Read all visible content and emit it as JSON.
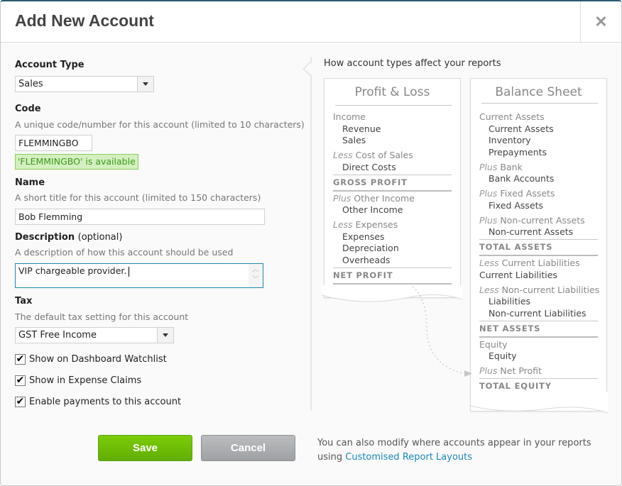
{
  "dialog": {
    "title": "Add New Account",
    "close_icon": "close-icon"
  },
  "form": {
    "account_type": {
      "label": "Account Type",
      "value": "Sales"
    },
    "code": {
      "label": "Code",
      "hint": "A unique code/number for this account (limited to 10 characters)",
      "value": "FLEMMINGBO",
      "availability": "'FLEMMINGBO' is available"
    },
    "name": {
      "label": "Name",
      "hint": "A short title for this account (limited to 150 characters)",
      "value": "Bob Flemming"
    },
    "description": {
      "label": "Description",
      "optional": "(optional)",
      "hint": "A description of how this account should be used",
      "value": "VIP chargeable provider."
    },
    "tax": {
      "label": "Tax",
      "hint": "The default tax setting for this account",
      "value": "GST Free Income"
    },
    "checkboxes": [
      {
        "label": "Show on Dashboard Watchlist",
        "checked": true
      },
      {
        "label": "Show in Expense Claims",
        "checked": true
      },
      {
        "label": "Enable payments to this account",
        "checked": true
      }
    ]
  },
  "reports": {
    "title": "How account types affect your reports",
    "profit_loss": {
      "heading": "Profit & Loss",
      "lines": [
        {
          "type": "grp",
          "prefix": "",
          "text": "Income"
        },
        {
          "type": "item",
          "text": "Revenue"
        },
        {
          "type": "item",
          "text": "Sales"
        },
        {
          "type": "grp",
          "prefix": "Less",
          "text": " Cost of Sales"
        },
        {
          "type": "item",
          "text": "Direct Costs"
        },
        {
          "type": "total",
          "text": "GROSS PROFIT"
        },
        {
          "type": "grp",
          "prefix": "Plus",
          "text": " Other Income"
        },
        {
          "type": "item",
          "text": "Other Income"
        },
        {
          "type": "grp",
          "prefix": "Less",
          "text": " Expenses"
        },
        {
          "type": "item",
          "text": "Expenses"
        },
        {
          "type": "item",
          "text": "Depreciation"
        },
        {
          "type": "item",
          "text": "Overheads"
        },
        {
          "type": "total",
          "text": "NET PROFIT"
        }
      ]
    },
    "balance_sheet": {
      "heading": "Balance Sheet",
      "lines": [
        {
          "type": "grp",
          "prefix": "",
          "text": "Current Assets"
        },
        {
          "type": "item",
          "text": "Current Assets"
        },
        {
          "type": "item",
          "text": "Inventory"
        },
        {
          "type": "item",
          "text": "Prepayments"
        },
        {
          "type": "grp",
          "prefix": "Plus",
          "text": " Bank"
        },
        {
          "type": "item",
          "text": "Bank Accounts"
        },
        {
          "type": "grp",
          "prefix": "Plus",
          "text": " Fixed Assets"
        },
        {
          "type": "item",
          "text": "Fixed Assets"
        },
        {
          "type": "grp",
          "prefix": "Plus",
          "text": " Non-current Assets"
        },
        {
          "type": "item",
          "text": "Non-current Assets"
        },
        {
          "type": "total",
          "text": "TOTAL ASSETS"
        },
        {
          "type": "grp",
          "prefix": "Less",
          "text": " Current Liabilities"
        },
        {
          "type": "item0",
          "text": "Current Liabilities"
        },
        {
          "type": "grp",
          "prefix": "Less",
          "text": " Non-current Liabilities"
        },
        {
          "type": "item",
          "text": "Liabilities"
        },
        {
          "type": "item",
          "text": "Non-current Liabilities"
        },
        {
          "type": "total",
          "text": "NET ASSETS"
        },
        {
          "type": "grp",
          "prefix": "",
          "text": "Equity"
        },
        {
          "type": "item",
          "text": "Equity"
        },
        {
          "type": "grp",
          "prefix": "Plus",
          "text": " Net Profit"
        },
        {
          "type": "total",
          "text": "TOTAL EQUITY"
        }
      ]
    }
  },
  "footer": {
    "save_label": "Save",
    "cancel_label": "Cancel",
    "note": "You can also modify where accounts appear in your reports",
    "note_prefix": "using ",
    "link_label": "Customised Report Layouts"
  },
  "colors": {
    "save_green": "#6ab807",
    "cancel_gray": "#a9acaf",
    "link_blue": "#1b88b8",
    "available_green": "#3b9a1a",
    "focus_blue": "#1a8ab0"
  }
}
